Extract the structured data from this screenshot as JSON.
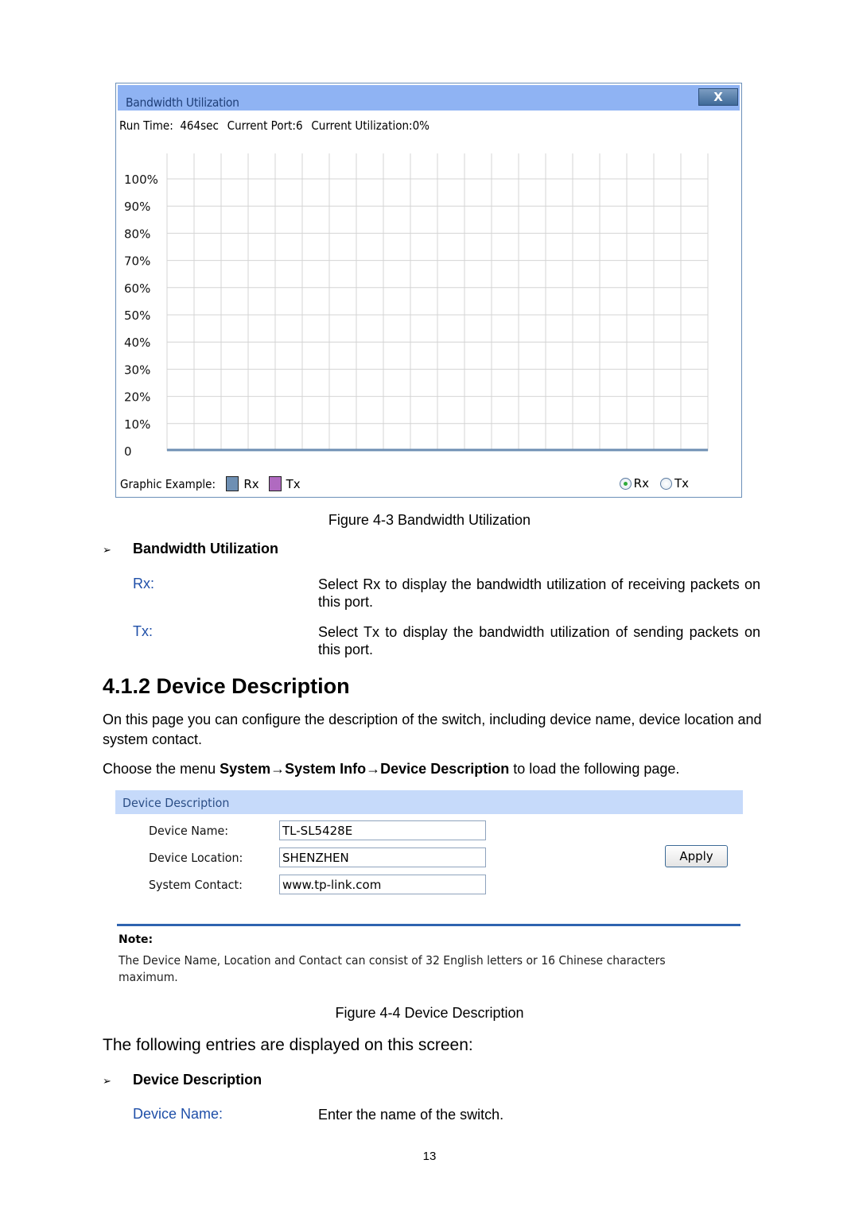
{
  "figure_4_3": {
    "window_title": "Bandwidth Utilization",
    "close_label": "X",
    "status": {
      "run_time": "Run Time:  464sec",
      "current_port": "Current Port:6",
      "current_utilization": "Current Utilization:0%"
    },
    "legend": {
      "label": "Graphic Example:",
      "items": [
        {
          "name": "Rx",
          "color": "#6e8fb3"
        },
        {
          "name": "Tx",
          "color": "#b06ac0"
        }
      ]
    },
    "radios": [
      {
        "label": "Rx",
        "checked": true
      },
      {
        "label": "Tx",
        "checked": false
      }
    ],
    "caption": "Figure 4-3 Bandwidth Utilization"
  },
  "chart_data": {
    "type": "line",
    "title": "Bandwidth Utilization",
    "xlabel": "",
    "ylabel": "",
    "ylim": [
      0,
      100
    ],
    "yticks": [
      "0",
      "10%",
      "20%",
      "30%",
      "40%",
      "50%",
      "60%",
      "70%",
      "80%",
      "90%",
      "100%"
    ],
    "grid": true,
    "x_divisions": 20,
    "series": [
      {
        "name": "Rx",
        "color": "#6e8fb3",
        "values": [
          0,
          0,
          0,
          0,
          0,
          0,
          0,
          0,
          0,
          0,
          0,
          0,
          0,
          0,
          0,
          0,
          0,
          0,
          0,
          0,
          0
        ]
      }
    ],
    "legend": "bottom-left"
  },
  "bandwidth_section": {
    "heading": "Bandwidth Utilization",
    "entries": [
      {
        "term": "Rx:",
        "definition": "Select Rx to display the bandwidth utilization of receiving packets on this port."
      },
      {
        "term": "Tx:",
        "definition": "Select Tx to display the bandwidth utilization of sending packets on this port."
      }
    ]
  },
  "section_4_1_2": {
    "title": "4.1.2 Device Description",
    "intro": "On this page you can configure the description of the switch, including device name, device location and system contact.",
    "menu_prefix": "Choose the menu ",
    "menu_path": "System→System Info→Device Description",
    "menu_suffix": " to load the following page."
  },
  "figure_4_4": {
    "panel_title": "Device Description",
    "fields": [
      {
        "label": "Device Name:",
        "value": "TL-SL5428E"
      },
      {
        "label": "Device Location:",
        "value": "SHENZHEN"
      },
      {
        "label": "System Contact:",
        "value": "www.tp-link.com"
      }
    ],
    "apply_label": "Apply",
    "note_title": "Note:",
    "note_text": "The Device Name, Location and Contact can consist of 32 English letters or 16 Chinese characters maximum.",
    "caption": "Figure 4-4 Device Description"
  },
  "entries_section": {
    "intro": "The following entries are displayed on this screen:",
    "heading": "Device Description",
    "entries": [
      {
        "term": "Device Name:",
        "definition": "Enter the name of the switch."
      }
    ]
  },
  "page_number": "13",
  "bullet_glyph": "➢"
}
